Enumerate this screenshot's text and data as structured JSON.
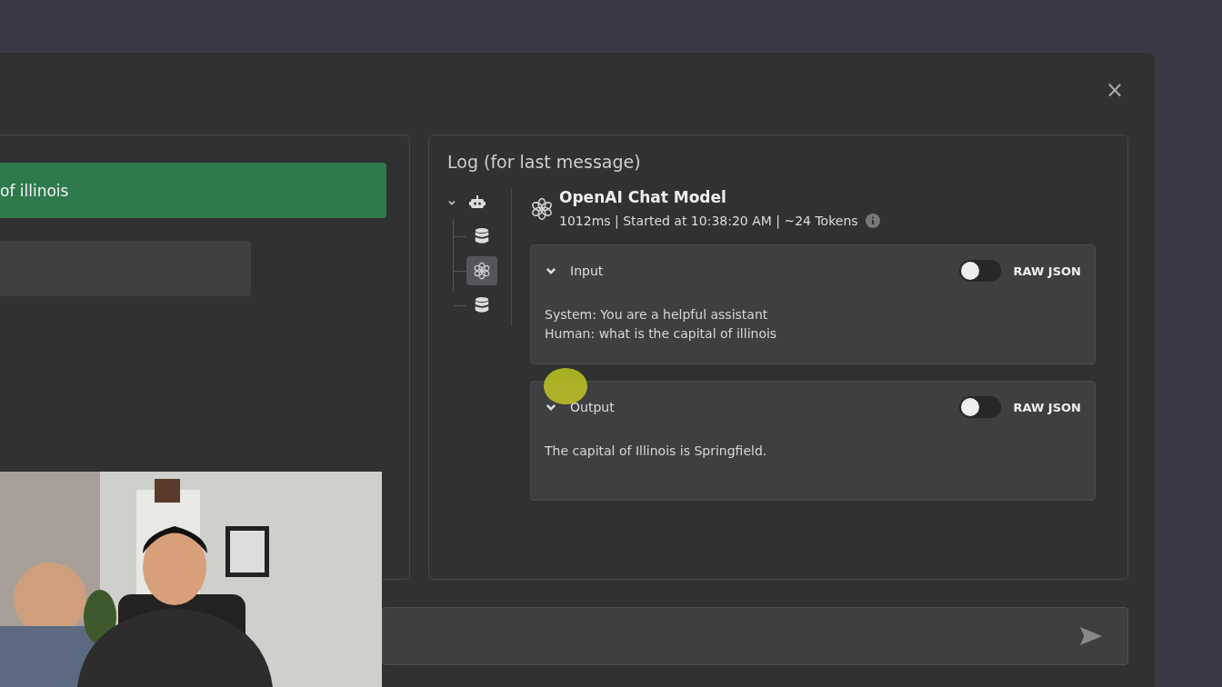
{
  "dialog": {
    "close": "×"
  },
  "chat": {
    "messages": [
      {
        "kind": "user",
        "text": "of illinois"
      },
      {
        "kind": "assistant"
      }
    ]
  },
  "log": {
    "title": "Log (for last message)",
    "tree": [
      {
        "kind": "agent",
        "expanded": true,
        "selected": false,
        "children": [
          {
            "kind": "database",
            "selected": false
          },
          {
            "kind": "model",
            "selected": true
          },
          {
            "kind": "database",
            "selected": false
          }
        ]
      }
    ],
    "run": {
      "title": "OpenAI Chat Model",
      "meta": "1012ms | Started at 10:38:20 AM | ~24 Tokens",
      "sections": [
        {
          "label": "Input",
          "expanded": true,
          "raw_json": false,
          "toggle_label": "RAW JSON",
          "lines": [
            "System: You are a helpful assistant",
            "Human: what is the capital of illinois"
          ]
        },
        {
          "label": "Output",
          "expanded": true,
          "raw_json": false,
          "toggle_label": "RAW JSON",
          "lines": [
            "The capital of Illinois is Springfield."
          ]
        }
      ]
    }
  }
}
